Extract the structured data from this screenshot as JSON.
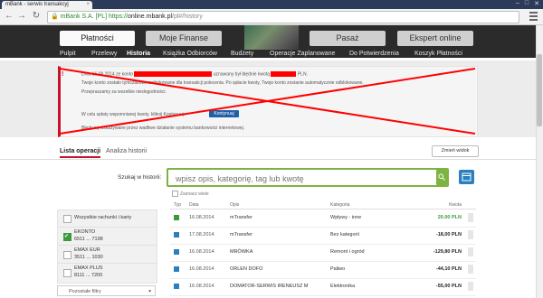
{
  "browser": {
    "tab_title": "mBank - serwis transakcyj",
    "url_org": "mBank S.A. [PL]",
    "url_scheme": "https://",
    "url_host": "online.mbank.pl",
    "url_path": "/pl#/history"
  },
  "header": {
    "main_buttons": [
      {
        "label": "Płatności",
        "active": true
      },
      {
        "label": "Moje Finanse",
        "active": false
      },
      {
        "label": "Pasaż",
        "active": false
      },
      {
        "label": "Ekspert online",
        "active": false
      }
    ],
    "subnav": [
      "Pulpit",
      "Przelewy",
      "Historia",
      "Książka Odbiorców",
      "Budżety",
      "Operacje Zaplanowane",
      "Do Potwierdzenia",
      "Koszyk Płatności"
    ],
    "subnav_active": "Historia"
  },
  "alert": {
    "line1_prefix": "Dnia 16.08.2014 ze konto",
    "line1_mid": "uznawany był błędnie kwotą",
    "line1_suffix": "PLN.",
    "line2": "Twoje konto zostało tymczasowo zablokowane dla transakcji polecenia. Po spłacie kwoty, Twoje konto zostanie automatycznie odblokowane.",
    "line3": "Przepraszamy za wszelkie niedogodności.",
    "line4": "W celu spłaty wspomnianej kwoty, kliknij Kontynuuj.",
    "continue_label": "Kontynuuj",
    "line5": "Błędy są wskazywane przez wadliwe działanie systemu bankowości internetowej.",
    "accent": "#c8102e"
  },
  "content": {
    "tabs": [
      "Lista operacji",
      "Analiza historii"
    ],
    "change_view": "Zmień widok",
    "search_label": "Szukaj w historii:",
    "search_placeholder": "wpisz opis, kategorię, tag lub kwotę",
    "fuzzy_label": "Zaznacz wiele"
  },
  "accounts": [
    {
      "name": "Wszystkie rachunki i karty",
      "sub": "",
      "checked": false
    },
    {
      "name": "EKONTO",
      "sub": "6511 ... 7198",
      "checked": true
    },
    {
      "name": "EMAX EUR",
      "sub": "3511 ... 1030",
      "checked": false
    },
    {
      "name": "EMAX PLUS",
      "sub": "8111 ... 7200",
      "checked": false
    }
  ],
  "more_filters": "Pozostałe filtry",
  "table": {
    "headers": {
      "typ": "Typ",
      "date": "Data",
      "desc": "Opis",
      "cat": "Kategoria",
      "amount": "Kwota"
    },
    "rows": [
      {
        "date": "16.08.2014",
        "desc": "mTransfer",
        "cat": "Wpływy - inne",
        "amount": "20.00 PLN",
        "positive": true
      },
      {
        "date": "17.08.2014",
        "desc": "mTransfer",
        "cat": "Bez kategorii",
        "amount": "-18,00 PLN",
        "positive": false
      },
      {
        "date": "16.08.2014",
        "desc": "MRÓWKA",
        "cat": "Remont i ogród",
        "amount": "-129,80 PLN",
        "positive": false
      },
      {
        "date": "16.08.2014",
        "desc": "ORLEN DOFO",
        "cat": "Paliwo",
        "amount": "-44,10 PLN",
        "positive": false
      },
      {
        "date": "16.08.2014",
        "desc": "DOMATOR-SERWIS IRENEUSZ M",
        "cat": "Elektronika",
        "amount": "-55,00 PLN",
        "positive": false
      }
    ]
  },
  "colors": {
    "green": "#7cb342",
    "blue": "#2a7fbf",
    "red": "#ff0000"
  }
}
